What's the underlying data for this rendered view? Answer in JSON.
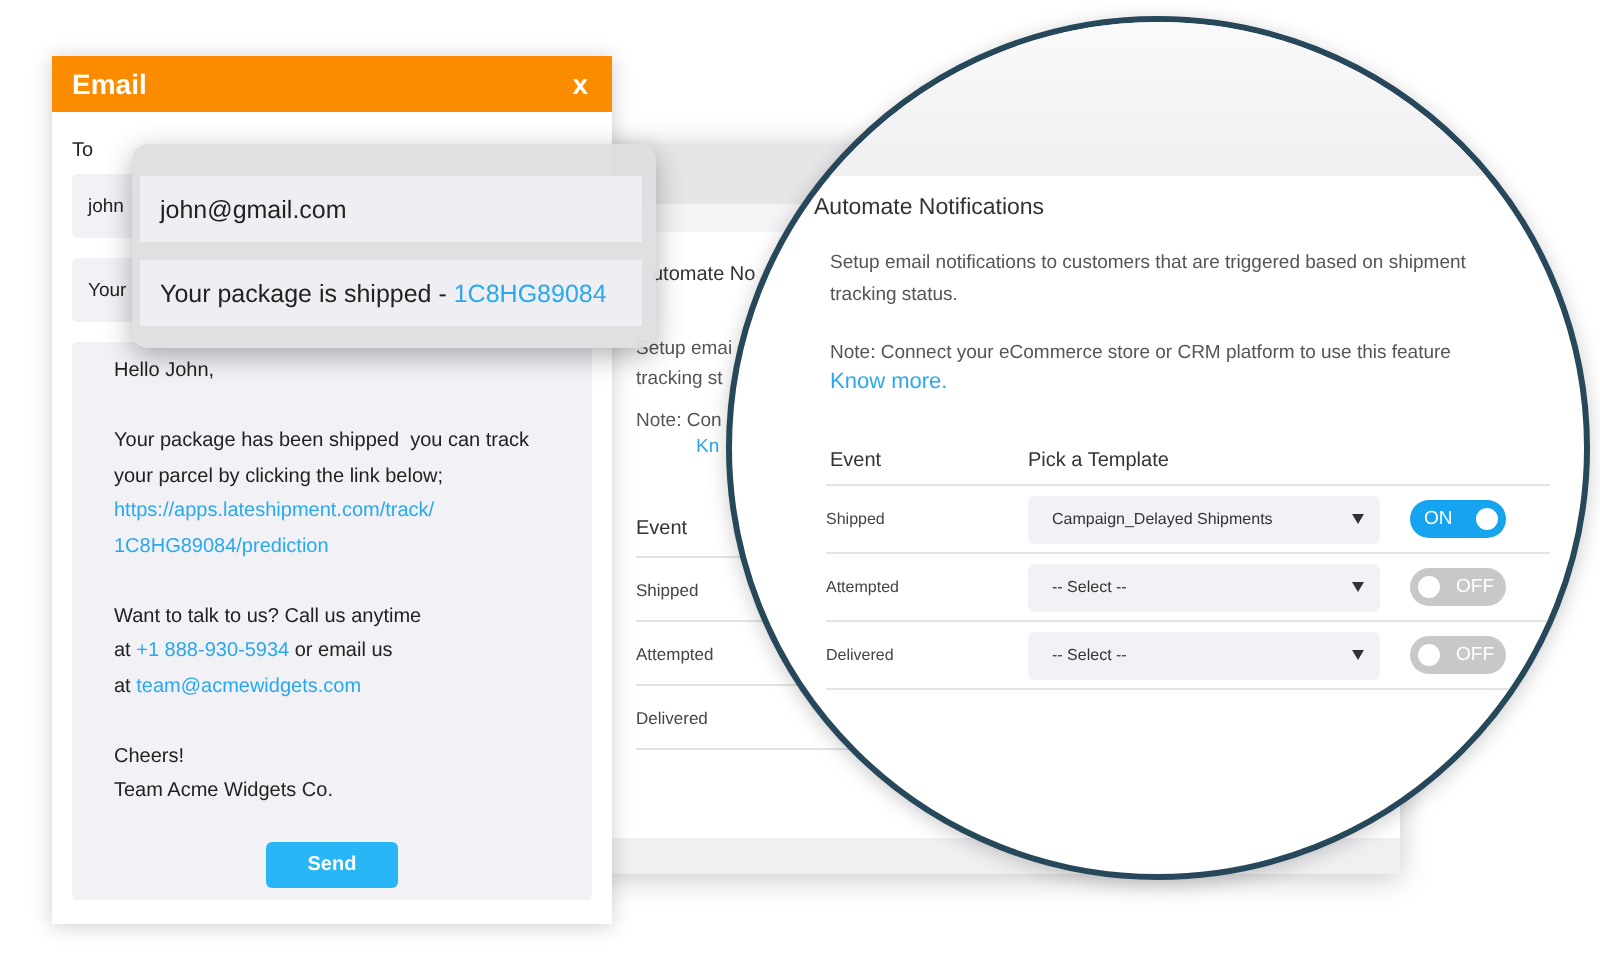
{
  "email_window": {
    "title": "Email",
    "close": "x",
    "to_label": "To",
    "to_value": "john",
    "subject_value": "Your",
    "body": [
      {
        "segments": [
          {
            "kind": "text",
            "text": "Hello John,"
          }
        ]
      },
      {
        "segments": [
          {
            "kind": "text",
            "text": "Your package has been shipped  you can track\nyour parcel by clicking the link below;"
          }
        ]
      },
      {
        "segments": [
          {
            "kind": "link",
            "text": "https://apps.lateshipment.com/track/"
          }
        ]
      },
      {
        "segments": [
          {
            "kind": "link",
            "text": "1C8HG89084/prediction"
          }
        ]
      },
      {
        "segments": [
          {
            "kind": "text",
            "text": "Want to talk to us? Call us anytime\nat "
          },
          {
            "kind": "link",
            "text": "+1 888-930-5934"
          },
          {
            "kind": "text",
            "text": " or email us\nat "
          },
          {
            "kind": "link",
            "text": "team@acmewidgets.com"
          }
        ]
      },
      {
        "segments": [
          {
            "kind": "text",
            "text": "Cheers!\nTeam Acme Widgets Co."
          }
        ]
      }
    ],
    "send": "Send"
  },
  "zoom_popup": {
    "to_value": "john@gmail.com",
    "subject_prefix": "Your package is shipped - ",
    "subject_code": "1C8HG89084"
  },
  "settings_page": {
    "title": "utomate No",
    "description": "Setup emai\ntracking st",
    "note": "Note: Con",
    "link": "Kn",
    "column": "Event",
    "events": [
      "Shipped",
      "Attempted",
      "Delivered"
    ]
  },
  "magnified": {
    "title": "Automate Notifications",
    "description": "Setup email notifications to customers that are triggered based on shipment\ntracking status.",
    "note": "Note: Connect your eCommerce store or CRM platform to use this feature",
    "link": "Know more.",
    "columns": [
      "Event",
      "Pick a Template"
    ],
    "rows": [
      {
        "event": "Shipped",
        "template": "Campaign_Delayed Shipments",
        "on": true,
        "toggle_label": "ON"
      },
      {
        "event": "Attempted",
        "template": "-- Select --",
        "on": false,
        "toggle_label": "OFF"
      },
      {
        "event": "Delivered",
        "template": "-- Select --",
        "on": false,
        "toggle_label": "OFF"
      }
    ]
  }
}
